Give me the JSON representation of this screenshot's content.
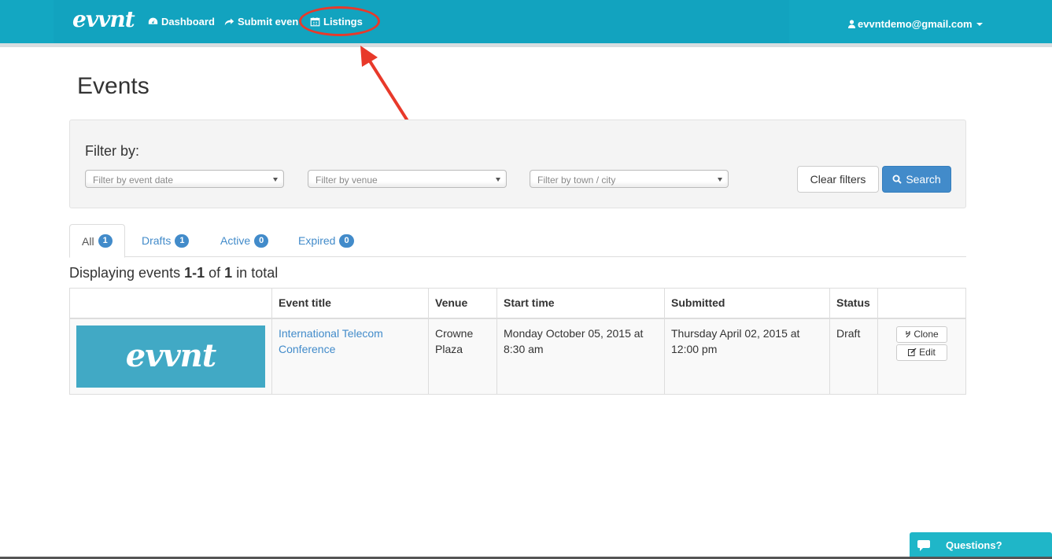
{
  "navbar": {
    "logo": "evvnt",
    "items": [
      {
        "label": "Dashboard",
        "icon": "dashboard-icon"
      },
      {
        "label": "Submit even",
        "icon": "share-arrow-icon"
      },
      {
        "label": "Listings",
        "icon": "calendar-icon"
      }
    ],
    "user_email": "evvntdemo@gmail.com",
    "colors": {
      "bar": "#13a7c2",
      "annotation": "#e8392a"
    }
  },
  "page": {
    "title": "Events"
  },
  "filters": {
    "label": "Filter by:",
    "date_placeholder": "Filter by event date",
    "venue_placeholder": "Filter by venue",
    "city_placeholder": "Filter by town / city",
    "clear_label": "Clear filters",
    "search_label": "Search"
  },
  "tabs": [
    {
      "label": "All",
      "count": "1"
    },
    {
      "label": "Drafts",
      "count": "1"
    },
    {
      "label": "Active",
      "count": "0"
    },
    {
      "label": "Expired",
      "count": "0"
    }
  ],
  "summary": {
    "prefix": "Displaying events",
    "range": "1-1",
    "of": "of",
    "total": "1",
    "suffix": "in total"
  },
  "table": {
    "headers": [
      "",
      "Event title",
      "Venue",
      "Start time",
      "Submitted",
      "Status",
      ""
    ],
    "rows": [
      {
        "thumb_text": "evvnt",
        "title": "International Telecom Conference",
        "venue": "Crowne Plaza",
        "start": "Monday October 05, 2015 at 8:30 am",
        "submitted": "Thursday April 02, 2015 at 12:00 pm",
        "status": "Draft",
        "clone_label": "Clone",
        "edit_label": "Edit"
      }
    ]
  },
  "help": {
    "label": "Questions?"
  }
}
